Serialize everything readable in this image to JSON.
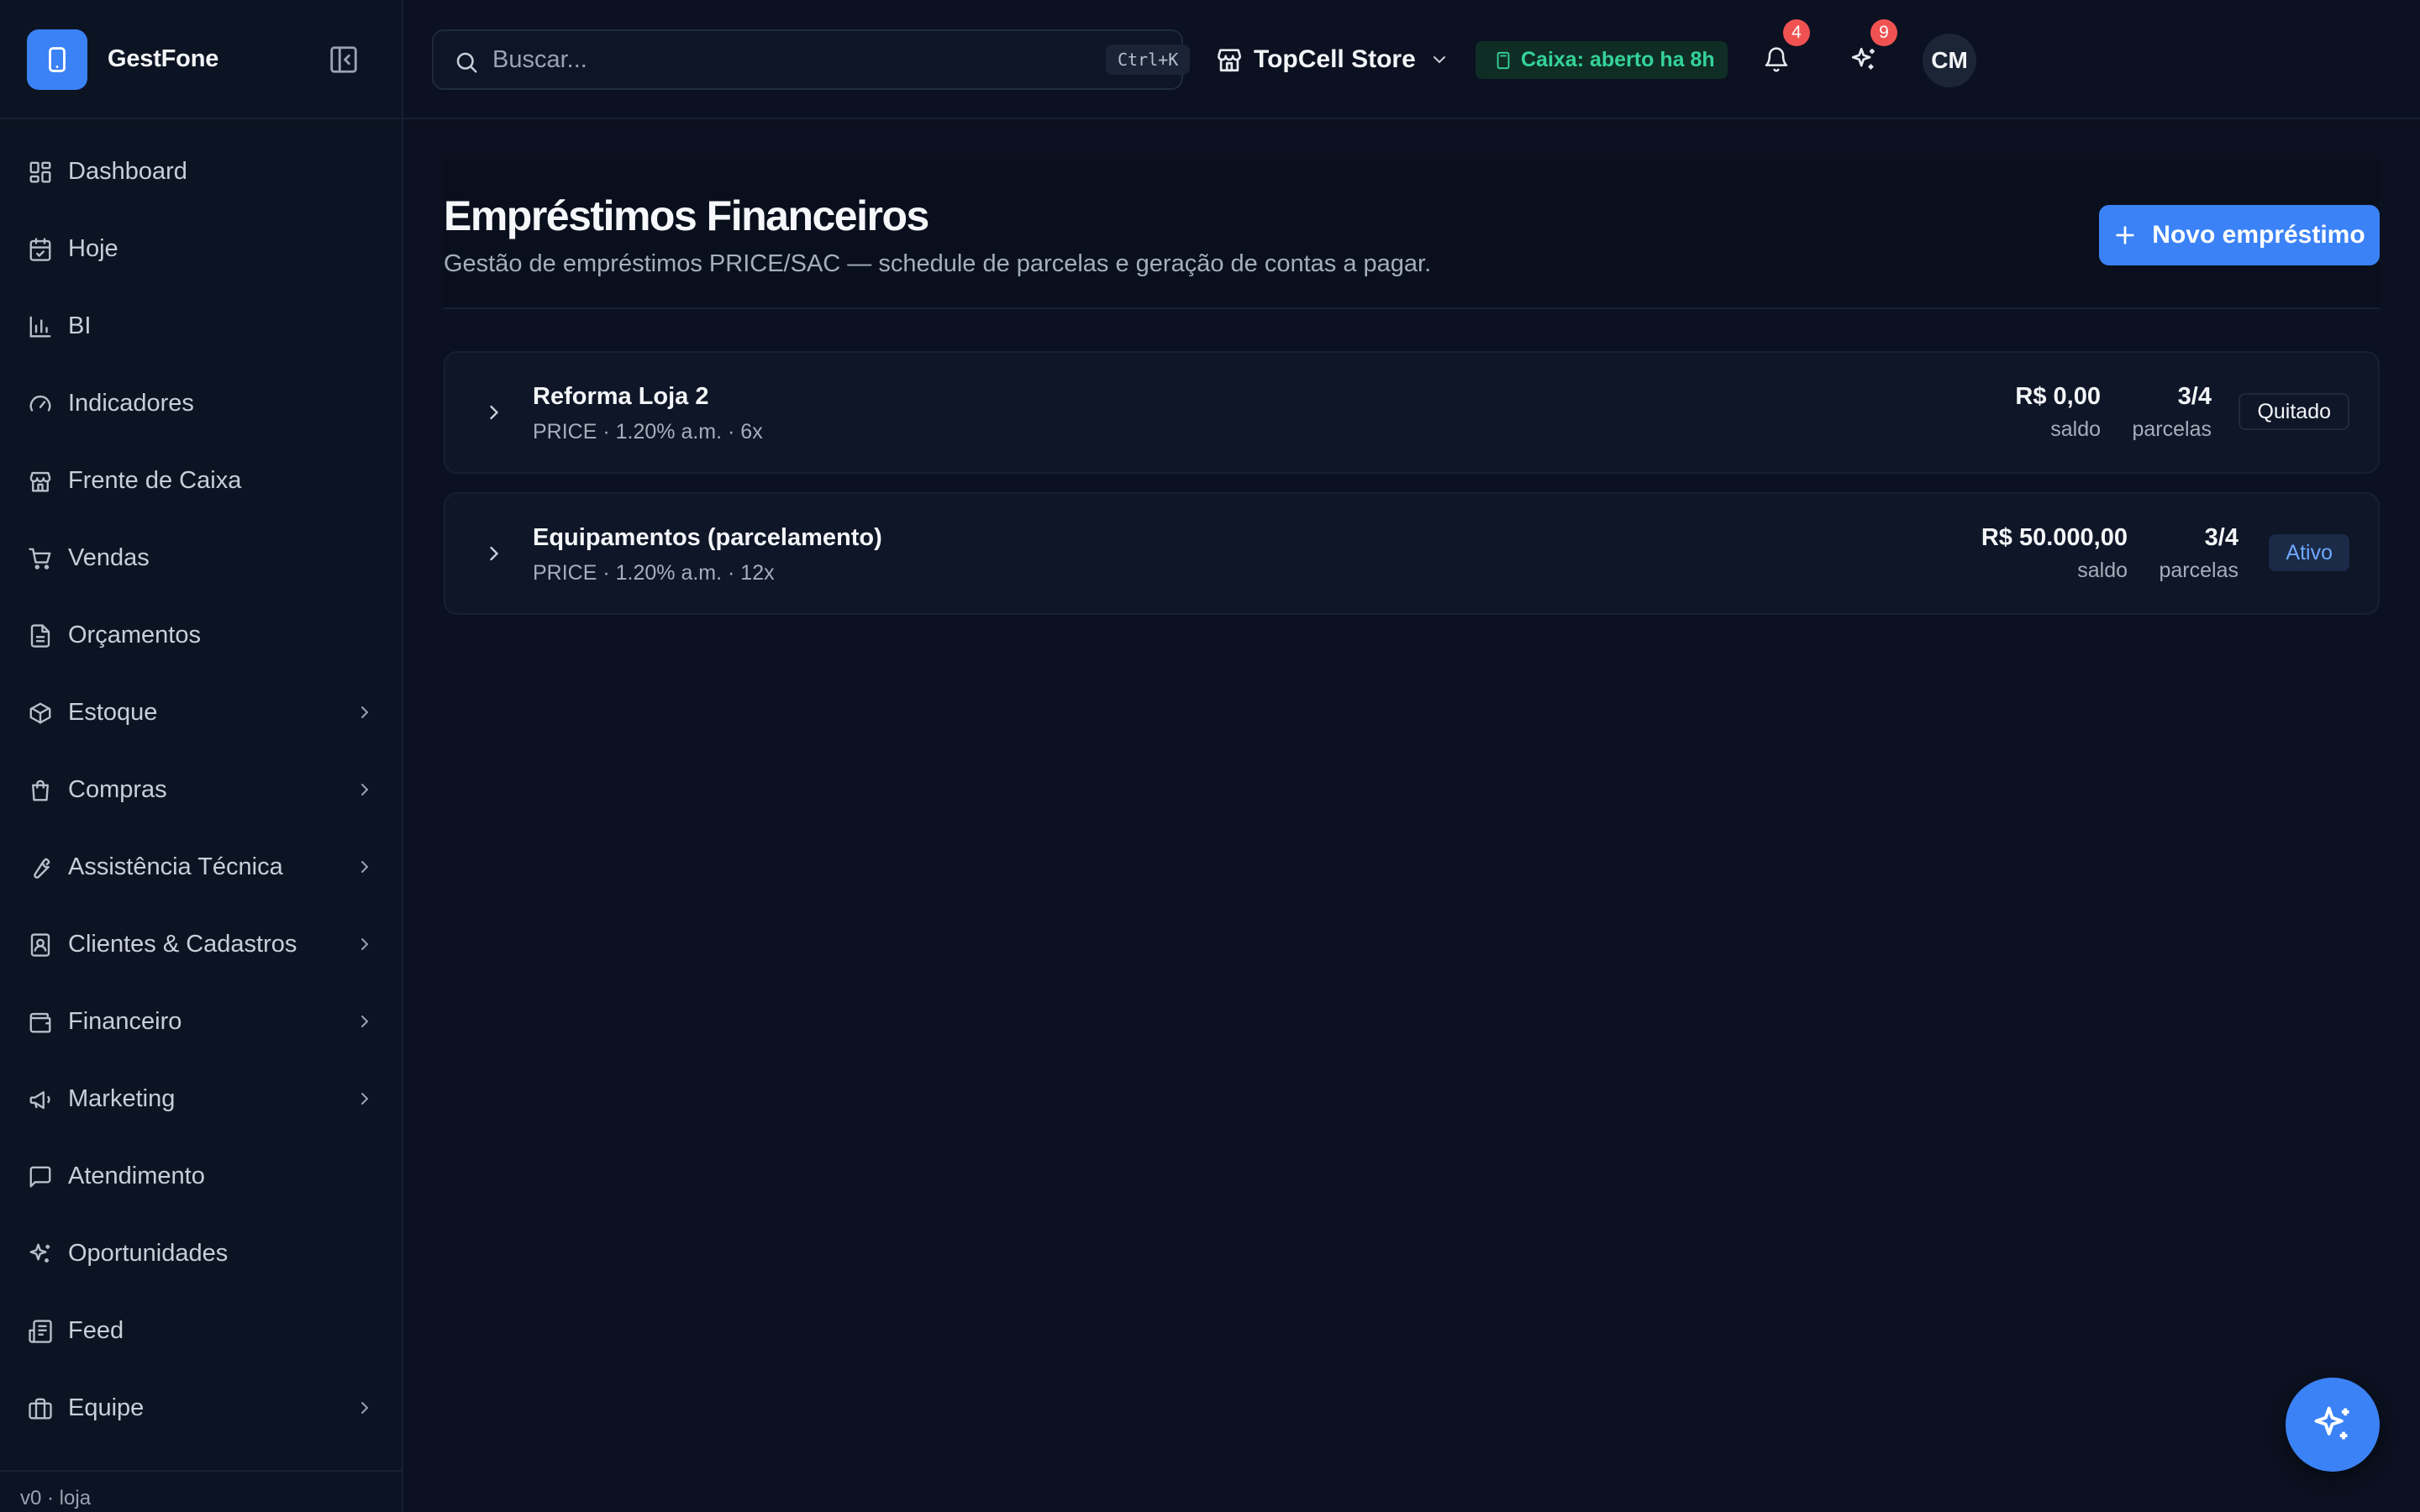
{
  "app": {
    "name": "GestFone",
    "version": "v0 · loja"
  },
  "sidebar": {
    "items": [
      {
        "label": "Dashboard",
        "icon": "dashboard-icon",
        "chevron": false
      },
      {
        "label": "Hoje",
        "icon": "calendar-check-icon",
        "chevron": false
      },
      {
        "label": "BI",
        "icon": "bar-chart-icon",
        "chevron": false
      },
      {
        "label": "Indicadores",
        "icon": "gauge-icon",
        "chevron": false
      },
      {
        "label": "Frente de Caixa",
        "icon": "store-icon",
        "chevron": false
      },
      {
        "label": "Vendas",
        "icon": "cart-icon",
        "chevron": false
      },
      {
        "label": "Orçamentos",
        "icon": "document-icon",
        "chevron": false
      },
      {
        "label": "Estoque",
        "icon": "package-icon",
        "chevron": true
      },
      {
        "label": "Compras",
        "icon": "shopping-bag-icon",
        "chevron": true
      },
      {
        "label": "Assistência Técnica",
        "icon": "wrench-icon",
        "chevron": true
      },
      {
        "label": "Clientes & Cadastros",
        "icon": "contact-icon",
        "chevron": true
      },
      {
        "label": "Financeiro",
        "icon": "wallet-icon",
        "chevron": true
      },
      {
        "label": "Marketing",
        "icon": "megaphone-icon",
        "chevron": true
      },
      {
        "label": "Atendimento",
        "icon": "chat-icon",
        "chevron": false
      },
      {
        "label": "Oportunidades",
        "icon": "sparkles-icon",
        "chevron": false
      },
      {
        "label": "Feed",
        "icon": "newspaper-icon",
        "chevron": false
      },
      {
        "label": "Equipe",
        "icon": "briefcase-icon",
        "chevron": true
      }
    ]
  },
  "topbar": {
    "search_placeholder": "Buscar...",
    "search_shortcut": "Ctrl+K",
    "store_name": "TopCell Store",
    "cash_status": "Caixa: aberto ha 8h",
    "notifications_count": "4",
    "ai_count": "9",
    "user_initials": "CM"
  },
  "page": {
    "title": "Empréstimos Financeiros",
    "subtitle": "Gestão de empréstimos PRICE/SAC — schedule de parcelas e geração de contas a pagar.",
    "new_button": "Novo empréstimo"
  },
  "loans": [
    {
      "name": "Reforma Loja 2",
      "meta": "PRICE · 1.20% a.m. · 6x",
      "balance": "R$ 0,00",
      "balance_label": "saldo",
      "installments": "3/4",
      "installments_label": "parcelas",
      "status": "Quitado",
      "status_kind": "paid"
    },
    {
      "name": "Equipamentos (parcelamento)",
      "meta": "PRICE · 1.20% a.m. · 12x",
      "balance": "R$ 50.000,00",
      "balance_label": "saldo",
      "installments": "3/4",
      "installments_label": "parcelas",
      "status": "Ativo",
      "status_kind": "active"
    }
  ],
  "colors": {
    "accent": "#3b82f6",
    "background": "#0b1120",
    "success": "#34d399",
    "badge": "#f05252"
  }
}
